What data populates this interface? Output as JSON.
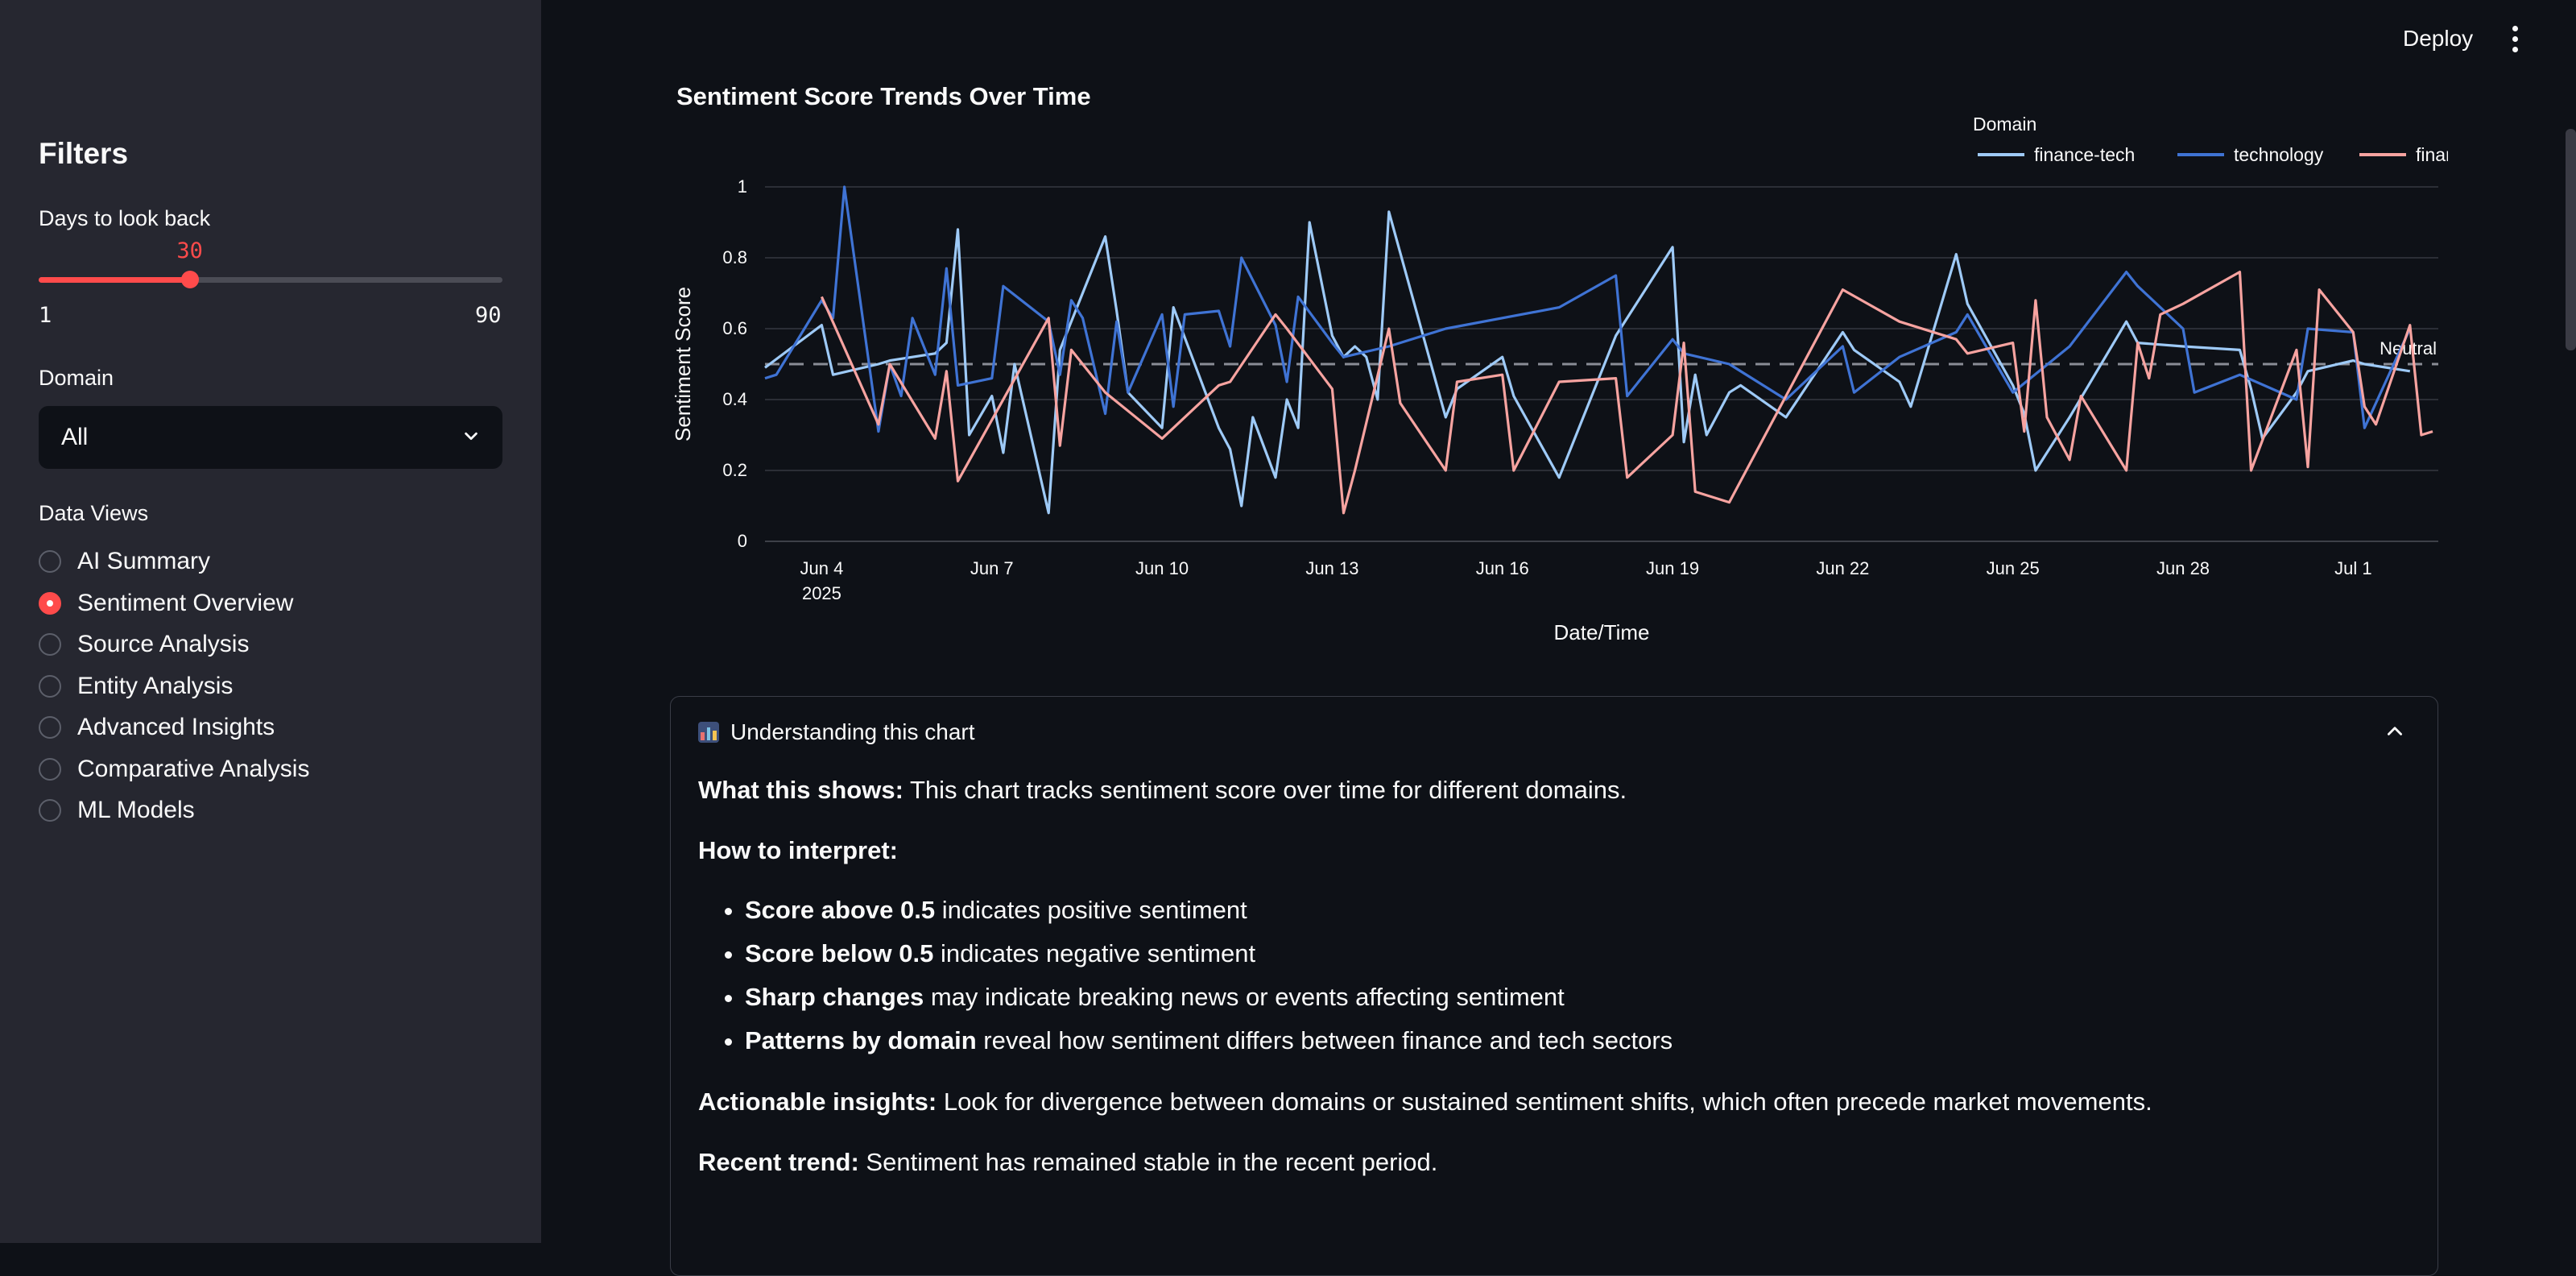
{
  "header": {
    "deploy_label": "Deploy",
    "menu_icon": "kebab-menu-icon"
  },
  "sidebar": {
    "title": "Filters",
    "days_slider": {
      "label": "Days to look back",
      "value": 30,
      "value_text": "30",
      "min": 1,
      "max": 90,
      "min_text": "1",
      "max_text": "90"
    },
    "domain_select": {
      "label": "Domain",
      "value": "All"
    },
    "views": {
      "label": "Data Views",
      "options": [
        "AI Summary",
        "Sentiment Overview",
        "Source Analysis",
        "Entity Analysis",
        "Advanced Insights",
        "Comparative Analysis",
        "ML Models"
      ],
      "selected": "Sentiment Overview"
    }
  },
  "chart_data": {
    "type": "line",
    "title": "Sentiment Score Trends Over Time",
    "xlabel": "Date/Time",
    "ylabel": "Sentiment Score",
    "x_start": "2025-06-03",
    "x_end": "2025-07-02",
    "x_ticks": [
      "Jun 4",
      "Jun 7",
      "Jun 10",
      "Jun 13",
      "Jun 16",
      "Jun 19",
      "Jun 22",
      "Jun 25",
      "Jun 28",
      "Jul 1"
    ],
    "x_tick_year": "2025",
    "y_ticks": [
      "0",
      "0.2",
      "0.4",
      "0.6",
      "0.8",
      "1"
    ],
    "ylim": [
      0,
      1
    ],
    "legend_title": "Domain",
    "legend_position": "top-right",
    "grid": true,
    "reference_line": {
      "y": 0.5,
      "label": "Neutral",
      "style": "dashed"
    },
    "series": [
      {
        "name": "finance-tech",
        "color": "#9ecaf7",
        "points": [
          [
            "2025-06-03",
            0.49
          ],
          [
            "2025-06-04",
            0.61
          ],
          [
            "2025-06-04",
            0.47
          ],
          [
            "2025-06-05",
            0.5
          ],
          [
            "2025-06-05",
            0.51
          ],
          [
            "2025-06-06",
            0.53
          ],
          [
            "2025-06-06",
            0.56
          ],
          [
            "2025-06-06",
            0.88
          ],
          [
            "2025-06-06",
            0.3
          ],
          [
            "2025-06-07",
            0.41
          ],
          [
            "2025-06-07",
            0.25
          ],
          [
            "2025-06-07",
            0.5
          ],
          [
            "2025-06-08",
            0.08
          ],
          [
            "2025-06-08",
            0.54
          ],
          [
            "2025-06-09",
            0.86
          ],
          [
            "2025-06-09",
            0.65
          ],
          [
            "2025-06-09",
            0.42
          ],
          [
            "2025-06-10",
            0.32
          ],
          [
            "2025-06-10",
            0.66
          ],
          [
            "2025-06-11",
            0.32
          ],
          [
            "2025-06-11",
            0.26
          ],
          [
            "2025-06-11",
            0.1
          ],
          [
            "2025-06-11",
            0.35
          ],
          [
            "2025-06-12",
            0.18
          ],
          [
            "2025-06-12",
            0.4
          ],
          [
            "2025-06-12",
            0.32
          ],
          [
            "2025-06-12",
            0.9
          ],
          [
            "2025-06-13",
            0.58
          ],
          [
            "2025-06-13",
            0.52
          ],
          [
            "2025-06-13",
            0.55
          ],
          [
            "2025-06-13",
            0.52
          ],
          [
            "2025-06-13",
            0.4
          ],
          [
            "2025-06-14",
            0.93
          ],
          [
            "2025-06-15",
            0.35
          ],
          [
            "2025-06-15",
            0.43
          ],
          [
            "2025-06-16",
            0.52
          ],
          [
            "2025-06-16",
            0.41
          ],
          [
            "2025-06-17",
            0.18
          ],
          [
            "2025-06-18",
            0.58
          ],
          [
            "2025-06-19",
            0.83
          ],
          [
            "2025-06-19",
            0.28
          ],
          [
            "2025-06-19",
            0.47
          ],
          [
            "2025-06-19",
            0.3
          ],
          [
            "2025-06-20",
            0.42
          ],
          [
            "2025-06-20",
            0.44
          ],
          [
            "2025-06-21",
            0.35
          ],
          [
            "2025-06-22",
            0.59
          ],
          [
            "2025-06-22",
            0.54
          ],
          [
            "2025-06-23",
            0.45
          ],
          [
            "2025-06-23",
            0.38
          ],
          [
            "2025-06-24",
            0.81
          ],
          [
            "2025-06-24",
            0.67
          ],
          [
            "2025-06-25",
            0.44
          ],
          [
            "2025-06-25",
            0.36
          ],
          [
            "2025-06-25",
            0.2
          ],
          [
            "2025-06-26",
            0.35
          ],
          [
            "2025-06-27",
            0.62
          ],
          [
            "2025-06-27",
            0.56
          ],
          [
            "2025-06-28",
            0.55
          ],
          [
            "2025-06-29",
            0.54
          ],
          [
            "2025-06-29",
            0.43
          ],
          [
            "2025-06-29",
            0.29
          ],
          [
            "2025-06-30",
            0.42
          ],
          [
            "2025-06-30",
            0.48
          ],
          [
            "2025-07-01",
            0.51
          ],
          [
            "2025-07-01",
            0.5
          ],
          [
            "2025-07-02",
            0.48
          ]
        ]
      },
      {
        "name": "technology",
        "color": "#3f73d4",
        "points": [
          [
            "2025-06-03",
            0.46
          ],
          [
            "2025-06-03",
            0.47
          ],
          [
            "2025-06-04",
            0.68
          ],
          [
            "2025-06-04",
            0.63
          ],
          [
            "2025-06-04",
            1.0
          ],
          [
            "2025-06-05",
            0.31
          ],
          [
            "2025-06-05",
            0.5
          ],
          [
            "2025-06-05",
            0.41
          ],
          [
            "2025-06-05",
            0.63
          ],
          [
            "2025-06-06",
            0.47
          ],
          [
            "2025-06-06",
            0.77
          ],
          [
            "2025-06-06",
            0.44
          ],
          [
            "2025-06-07",
            0.46
          ],
          [
            "2025-06-07",
            0.72
          ],
          [
            "2025-06-08",
            0.62
          ],
          [
            "2025-06-08",
            0.47
          ],
          [
            "2025-06-08",
            0.68
          ],
          [
            "2025-06-08",
            0.63
          ],
          [
            "2025-06-09",
            0.36
          ],
          [
            "2025-06-09",
            0.62
          ],
          [
            "2025-06-09",
            0.42
          ],
          [
            "2025-06-10",
            0.64
          ],
          [
            "2025-06-10",
            0.38
          ],
          [
            "2025-06-10",
            0.64
          ],
          [
            "2025-06-11",
            0.65
          ],
          [
            "2025-06-11",
            0.55
          ],
          [
            "2025-06-11",
            0.8
          ],
          [
            "2025-06-12",
            0.61
          ],
          [
            "2025-06-12",
            0.45
          ],
          [
            "2025-06-12",
            0.69
          ],
          [
            "2025-06-13",
            0.56
          ],
          [
            "2025-06-13",
            0.52
          ],
          [
            "2025-06-14",
            0.55
          ],
          [
            "2025-06-15",
            0.6
          ],
          [
            "2025-06-17",
            0.66
          ],
          [
            "2025-06-18",
            0.75
          ],
          [
            "2025-06-18",
            0.41
          ],
          [
            "2025-06-19",
            0.57
          ],
          [
            "2025-06-19",
            0.53
          ],
          [
            "2025-06-20",
            0.5
          ],
          [
            "2025-06-21",
            0.4
          ],
          [
            "2025-06-22",
            0.55
          ],
          [
            "2025-06-22",
            0.42
          ],
          [
            "2025-06-23",
            0.52
          ],
          [
            "2025-06-24",
            0.59
          ],
          [
            "2025-06-24",
            0.64
          ],
          [
            "2025-06-25",
            0.42
          ],
          [
            "2025-06-26",
            0.55
          ],
          [
            "2025-06-27",
            0.76
          ],
          [
            "2025-06-27",
            0.72
          ],
          [
            "2025-06-28",
            0.6
          ],
          [
            "2025-06-28",
            0.42
          ],
          [
            "2025-06-29",
            0.47
          ],
          [
            "2025-06-30",
            0.4
          ],
          [
            "2025-06-30",
            0.6
          ],
          [
            "2025-07-01",
            0.59
          ],
          [
            "2025-07-01",
            0.32
          ],
          [
            "2025-07-02",
            0.6
          ]
        ]
      },
      {
        "name": "finance",
        "color": "#f7a3a0",
        "points": [
          [
            "2025-06-04",
            0.69
          ],
          [
            "2025-06-05",
            0.33
          ],
          [
            "2025-06-05",
            0.5
          ],
          [
            "2025-06-06",
            0.29
          ],
          [
            "2025-06-06",
            0.48
          ],
          [
            "2025-06-06",
            0.17
          ],
          [
            "2025-06-08",
            0.63
          ],
          [
            "2025-06-08",
            0.27
          ],
          [
            "2025-06-08",
            0.54
          ],
          [
            "2025-06-09",
            0.42
          ],
          [
            "2025-06-10",
            0.29
          ],
          [
            "2025-06-11",
            0.44
          ],
          [
            "2025-06-11",
            0.45
          ],
          [
            "2025-06-12",
            0.64
          ],
          [
            "2025-06-12",
            0.6
          ],
          [
            "2025-06-13",
            0.43
          ],
          [
            "2025-06-13",
            0.08
          ],
          [
            "2025-06-13",
            0.2
          ],
          [
            "2025-06-14",
            0.6
          ],
          [
            "2025-06-14",
            0.39
          ],
          [
            "2025-06-15",
            0.2
          ],
          [
            "2025-06-15",
            0.45
          ],
          [
            "2025-06-16",
            0.47
          ],
          [
            "2025-06-16",
            0.2
          ],
          [
            "2025-06-17",
            0.45
          ],
          [
            "2025-06-18",
            0.46
          ],
          [
            "2025-06-18",
            0.18
          ],
          [
            "2025-06-19",
            0.3
          ],
          [
            "2025-06-19",
            0.56
          ],
          [
            "2025-06-19",
            0.14
          ],
          [
            "2025-06-20",
            0.11
          ],
          [
            "2025-06-21",
            0.41
          ],
          [
            "2025-06-22",
            0.71
          ],
          [
            "2025-06-23",
            0.62
          ],
          [
            "2025-06-24",
            0.57
          ],
          [
            "2025-06-24",
            0.53
          ],
          [
            "2025-06-25",
            0.56
          ],
          [
            "2025-06-25",
            0.31
          ],
          [
            "2025-06-25",
            0.68
          ],
          [
            "2025-06-25",
            0.35
          ],
          [
            "2025-06-26",
            0.23
          ],
          [
            "2025-06-26",
            0.41
          ],
          [
            "2025-06-27",
            0.2
          ],
          [
            "2025-06-27",
            0.56
          ],
          [
            "2025-06-27",
            0.46
          ],
          [
            "2025-06-27",
            0.64
          ],
          [
            "2025-06-28",
            0.67
          ],
          [
            "2025-06-29",
            0.76
          ],
          [
            "2025-06-29",
            0.2
          ],
          [
            "2025-06-30",
            0.54
          ],
          [
            "2025-06-30",
            0.21
          ],
          [
            "2025-06-30",
            0.71
          ],
          [
            "2025-07-01",
            0.59
          ],
          [
            "2025-07-01",
            0.38
          ],
          [
            "2025-07-01",
            0.33
          ],
          [
            "2025-07-02",
            0.61
          ],
          [
            "2025-07-02",
            0.3
          ],
          [
            "2025-07-02",
            0.31
          ]
        ]
      }
    ]
  },
  "expander": {
    "title": "Understanding this chart",
    "icon": "bar-chart-icon",
    "what_label": "What this shows:",
    "what_text": " This chart tracks sentiment score over time for different domains.",
    "how_label": "How to interpret:",
    "bullets": [
      {
        "bold": "Score above 0.5",
        "text": " indicates positive sentiment"
      },
      {
        "bold": "Score below 0.5",
        "text": " indicates negative sentiment"
      },
      {
        "bold": "Sharp changes",
        "text": " may indicate breaking news or events affecting sentiment"
      },
      {
        "bold": "Patterns by domain",
        "text": " reveal how sentiment differs between finance and tech sectors"
      }
    ],
    "actionable_label": "Actionable insights:",
    "actionable_text": " Look for divergence between domains or sustained sentiment shifts, which often precede market movements.",
    "recent_label": "Recent trend:",
    "recent_text": " Sentiment has remained stable in the recent period."
  },
  "colors": {
    "accent": "#ff4b4b",
    "sidebar_bg": "#262730",
    "main_bg": "#0e1117"
  }
}
